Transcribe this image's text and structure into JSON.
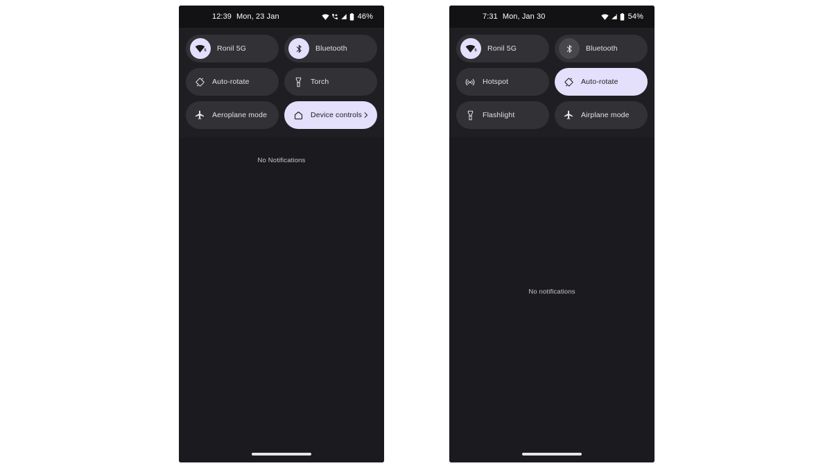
{
  "page": {
    "background": "#ffffff",
    "description": "Two Android quick-settings panel screenshots side by side"
  },
  "colors": {
    "phone_frame": "#121214",
    "screen_background": "#1b1b1f",
    "qs_panel_background": "#1f1f23",
    "tile_inactive": "#323136",
    "tile_active": "#e4dffb",
    "icon_badge_on": "#e4dffb",
    "icon_badge_off": "#48474c",
    "text_primary": "#e4e2e6",
    "text_on_active": "#1b1b1f",
    "nav_pill": "#e8e6ea"
  },
  "phones": [
    {
      "id": "phone-left",
      "status_bar": {
        "clock": "12:39",
        "date": "Mon, 23 Jan",
        "battery_percent": "46%",
        "icons": [
          "wifi-icon",
          "call-forward-icon",
          "signal-icon",
          "battery-icon"
        ]
      },
      "quick_settings": {
        "tiles": [
          {
            "key": "wifi",
            "label": "Ronil 5G",
            "icon": "wifi-icon",
            "icon_style": "badge",
            "state": "on",
            "badge_on": true,
            "tile_active": false,
            "wifi_superscript": "5"
          },
          {
            "key": "bluetooth",
            "label": "Bluetooth",
            "icon": "bluetooth-icon",
            "icon_style": "badge",
            "state": "on",
            "badge_on": true,
            "tile_active": false
          },
          {
            "key": "auto-rotate",
            "label": "Auto-rotate",
            "icon": "auto-rotate-icon",
            "icon_style": "plain",
            "state": "off",
            "tile_active": false
          },
          {
            "key": "torch",
            "label": "Torch",
            "icon": "flashlight-icon",
            "icon_style": "plain",
            "state": "off",
            "tile_active": false
          },
          {
            "key": "aeroplane-mode",
            "label": "Aeroplane mode",
            "icon": "airplane-icon",
            "icon_style": "plain",
            "state": "off",
            "tile_active": false
          },
          {
            "key": "device-controls",
            "label": "Device controls",
            "icon": "home-icon",
            "icon_style": "plain",
            "state": "on",
            "tile_active": true,
            "chevron": "chevron-right-icon"
          }
        ]
      },
      "notifications": {
        "empty_text": "No Notifications",
        "position": "top"
      },
      "nav_bar": {
        "gesture_pill": true
      }
    },
    {
      "id": "phone-right",
      "status_bar": {
        "clock": "7:31",
        "date": "Mon, Jan 30",
        "battery_percent": "54%",
        "icons": [
          "wifi-icon",
          "signal-icon",
          "battery-icon"
        ]
      },
      "quick_settings": {
        "tiles": [
          {
            "key": "wifi",
            "label": "Ronil 5G",
            "icon": "wifi-icon",
            "icon_style": "badge",
            "state": "on",
            "badge_on": true,
            "tile_active": false,
            "wifi_superscript": "5"
          },
          {
            "key": "bluetooth",
            "label": "Bluetooth",
            "icon": "bluetooth-icon",
            "icon_style": "badge",
            "state": "off",
            "badge_on": false,
            "tile_active": false
          },
          {
            "key": "hotspot",
            "label": "Hotspot",
            "icon": "hotspot-icon",
            "icon_style": "plain",
            "state": "off",
            "tile_active": false
          },
          {
            "key": "auto-rotate",
            "label": "Auto-rotate",
            "icon": "auto-rotate-icon",
            "icon_style": "plain",
            "state": "on",
            "tile_active": true
          },
          {
            "key": "flashlight",
            "label": "Flashlight",
            "icon": "flashlight-icon",
            "icon_style": "plain",
            "state": "off",
            "tile_active": false
          },
          {
            "key": "airplane-mode",
            "label": "Airplane mode",
            "icon": "airplane-icon",
            "icon_style": "plain",
            "state": "off",
            "tile_active": false
          }
        ]
      },
      "notifications": {
        "empty_text": "No notifications",
        "position": "middle"
      },
      "nav_bar": {
        "gesture_pill": true
      }
    }
  ]
}
